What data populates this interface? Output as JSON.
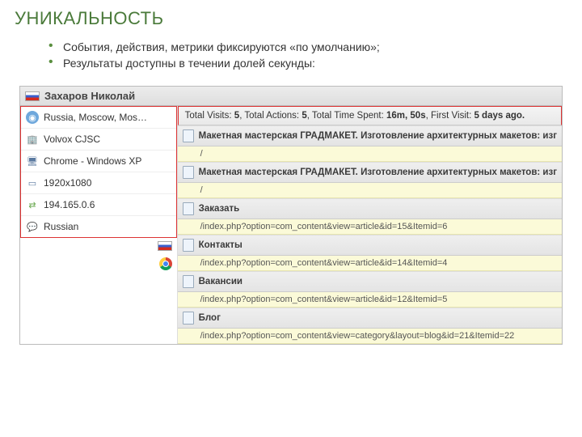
{
  "title": "УНИКАЛЬНОСТЬ",
  "bullets": [
    "События, действия, метрики фиксируются «по умолчанию»;",
    "Результаты доступны в течении долей секунды:"
  ],
  "visitor_name": "Захаров Николай",
  "left": {
    "location": "Russia, Moscow, Mos…",
    "org": "Volvox CJSC",
    "browser_os": "Chrome - Windows XP",
    "resolution": "1920x1080",
    "ip": "194.165.0.6",
    "language": "Russian"
  },
  "stats": {
    "l1": "Total Visits:",
    "v1": "5",
    "l2": ", Total Actions:",
    "v2": "5",
    "l3": ", Total Time Spent:",
    "v3": "16m, 50s",
    "l4": ", First Visit:",
    "v4": "5 days ago."
  },
  "pages": [
    {
      "title": "Макетная мастерская ГРАДМАКЕТ. Изготовление архитектурных макетов: изг",
      "url": "/"
    },
    {
      "title": "Макетная мастерская ГРАДМАКЕТ. Изготовление архитектурных макетов: изг",
      "url": "/"
    },
    {
      "title": "Заказать",
      "url": "/index.php?option=com_content&view=article&id=15&Itemid=6"
    },
    {
      "title": "Контакты",
      "url": "/index.php?option=com_content&view=article&id=14&Itemid=4"
    },
    {
      "title": "Вакансии",
      "url": "/index.php?option=com_content&view=article&id=12&Itemid=5"
    },
    {
      "title": "Блог",
      "url": "/index.php?option=com_content&view=category&layout=blog&id=21&Itemid=22"
    }
  ]
}
